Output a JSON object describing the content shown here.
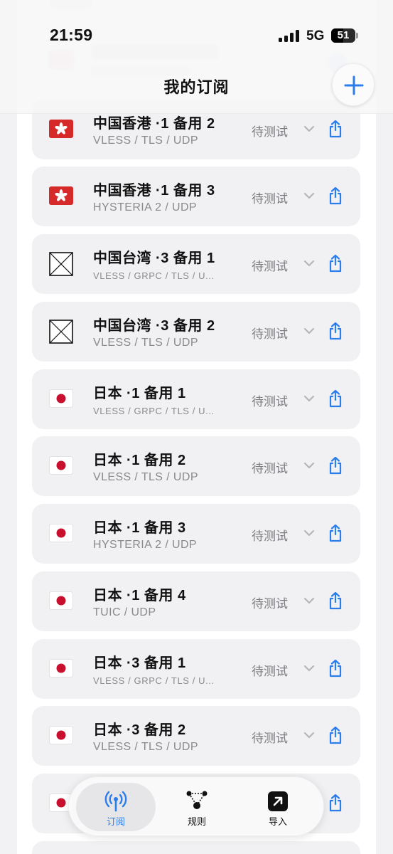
{
  "status_bar": {
    "time": "21:59",
    "network": "5G",
    "battery": "51",
    "battery_level": 0.51
  },
  "header": {
    "title": "我的订阅"
  },
  "colors": {
    "accent": "#2b7de9",
    "card": "#f1f1f3",
    "secondary_text": "#8a8a8e"
  },
  "nodes": [
    {
      "name": "中国香港 ·1 备用 2",
      "protocol": "VLESS / TLS / UDP",
      "status": "待测试",
      "flag": "hong-kong-flag"
    },
    {
      "name": "中国香港 ·1 备用 3",
      "protocol": "HYSTERIA 2 / UDP",
      "status": "待测试",
      "flag": "hong-kong-flag"
    },
    {
      "name": "中国台湾 ·3 备用 1",
      "protocol": "VLESS / GRPC / TLS / U...",
      "status": "待测试",
      "flag": "missing-flag"
    },
    {
      "name": "中国台湾 ·3 备用 2",
      "protocol": "VLESS / TLS / UDP",
      "status": "待测试",
      "flag": "missing-flag"
    },
    {
      "name": "日本 ·1 备用 1",
      "protocol": "VLESS / GRPC / TLS / U...",
      "status": "待测试",
      "flag": "japan-flag"
    },
    {
      "name": "日本 ·1 备用 2",
      "protocol": "VLESS / TLS / UDP",
      "status": "待测试",
      "flag": "japan-flag"
    },
    {
      "name": "日本 ·1 备用 3",
      "protocol": "HYSTERIA 2 / UDP",
      "status": "待测试",
      "flag": "japan-flag"
    },
    {
      "name": "日本 ·1 备用 4",
      "protocol": "TUIC / UDP",
      "status": "待测试",
      "flag": "japan-flag"
    },
    {
      "name": "日本 ·3 备用 1",
      "protocol": "VLESS / GRPC / TLS / U...",
      "status": "待测试",
      "flag": "japan-flag"
    },
    {
      "name": "日本 ·3 备用 2",
      "protocol": "VLESS / TLS / UDP",
      "status": "待测试",
      "flag": "japan-flag"
    }
  ],
  "tabbar": {
    "items": [
      {
        "label": "订阅",
        "icon": "antenna-icon",
        "active": true
      },
      {
        "label": "规则",
        "icon": "rules-nodes-icon",
        "active": false
      },
      {
        "label": "导入",
        "icon": "import-arrow-icon",
        "active": false
      }
    ]
  }
}
